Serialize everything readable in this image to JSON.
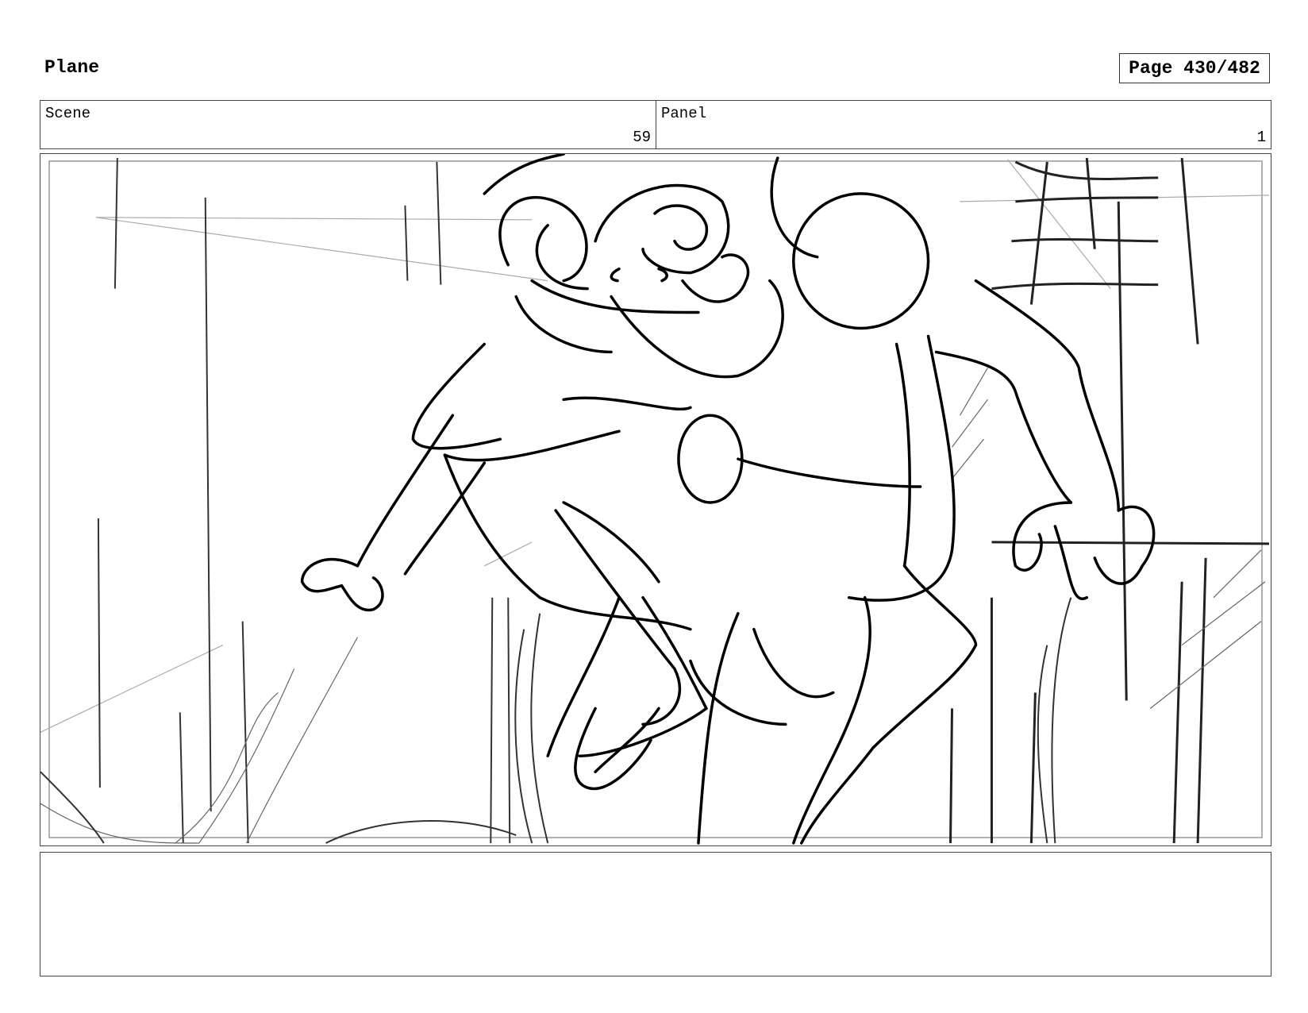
{
  "document": {
    "title": "Plane",
    "page_label": "Page 430/482"
  },
  "header": {
    "scene_label": "Scene",
    "scene_value": "59",
    "panel_label": "Panel",
    "panel_value": "1"
  },
  "frame": {
    "image_name": "storyboard-sketch"
  },
  "notes": {
    "text": ""
  }
}
